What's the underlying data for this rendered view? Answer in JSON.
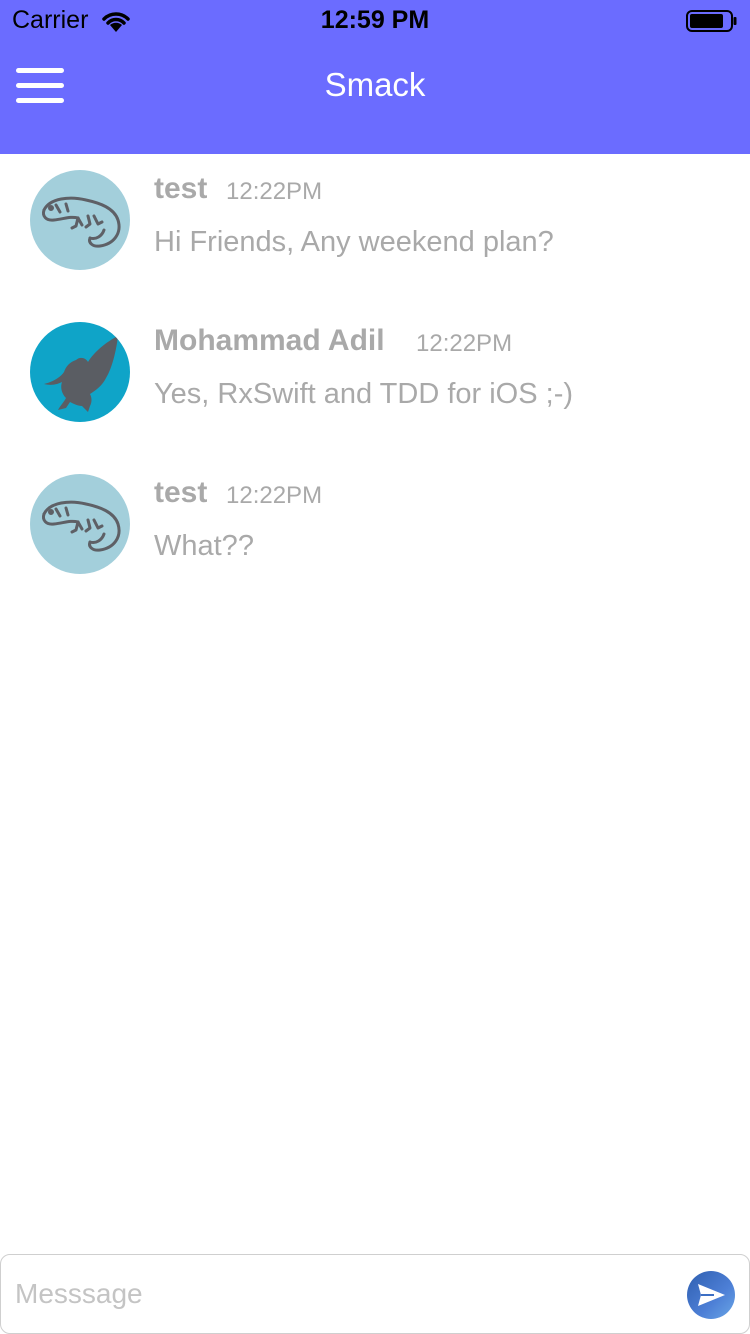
{
  "status_bar": {
    "carrier": "Carrier",
    "time": "12:59 PM"
  },
  "header": {
    "title": "Smack",
    "background": "#6b6cff"
  },
  "messages": [
    {
      "author": "test",
      "time": "12:22PM",
      "text": "Hi Friends, Any weekend plan?",
      "avatar_icon": "lizard-icon",
      "avatar_color": "#a3cfdb"
    },
    {
      "author": "Mohammad Adil",
      "time": "12:22PM",
      "text": "Yes, RxSwift and TDD for iOS ;-)",
      "avatar_icon": "eagle-icon",
      "avatar_color": "#0fa4c8"
    },
    {
      "author": "test",
      "time": "12:22PM",
      "text": "What??",
      "avatar_icon": "lizard-icon",
      "avatar_color": "#a3cfdb"
    }
  ],
  "composer": {
    "placeholder": "Messsage",
    "value": ""
  },
  "colors": {
    "text_muted": "#a9a9a9",
    "send_button": "#3d6fc4"
  }
}
